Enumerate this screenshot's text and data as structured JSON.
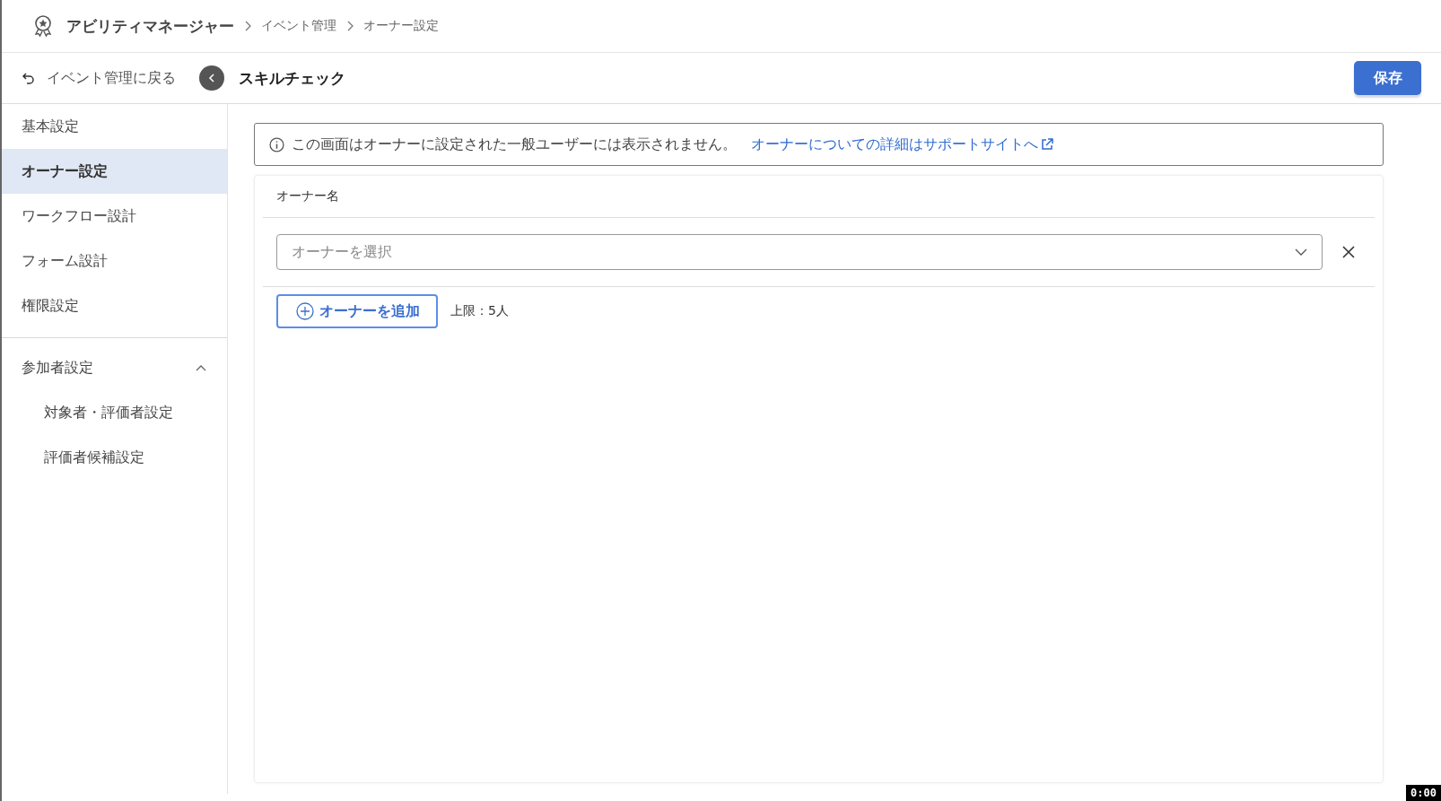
{
  "breadcrumb": {
    "app": "アビリティマネージャー",
    "items": [
      "イベント管理",
      "オーナー設定"
    ]
  },
  "toolbar": {
    "back_link": "イベント管理に戻る",
    "title": "スキルチェック",
    "save_button": "保存"
  },
  "sidebar": {
    "items": [
      {
        "label": "基本設定",
        "selected": false
      },
      {
        "label": "オーナー設定",
        "selected": true
      },
      {
        "label": "ワークフロー設計",
        "selected": false
      },
      {
        "label": "フォーム設計",
        "selected": false
      },
      {
        "label": "権限設定",
        "selected": false
      }
    ],
    "groups": [
      {
        "label": "参加者設定",
        "expanded": true,
        "children": [
          {
            "label": "対象者・評価者設定",
            "selected": false
          },
          {
            "label": "評価者候補設定",
            "selected": false
          }
        ]
      }
    ]
  },
  "notice": {
    "text": "この画面はオーナーに設定された一般ユーザーには表示されません。",
    "link": "オーナーについての詳細はサポートサイトへ"
  },
  "owner_section": {
    "heading": "オーナー名",
    "select": {
      "placeholder": "オーナーを選択"
    },
    "add_button": "オーナーを追加",
    "limit": "上限：5人"
  },
  "timer": "0:00"
}
